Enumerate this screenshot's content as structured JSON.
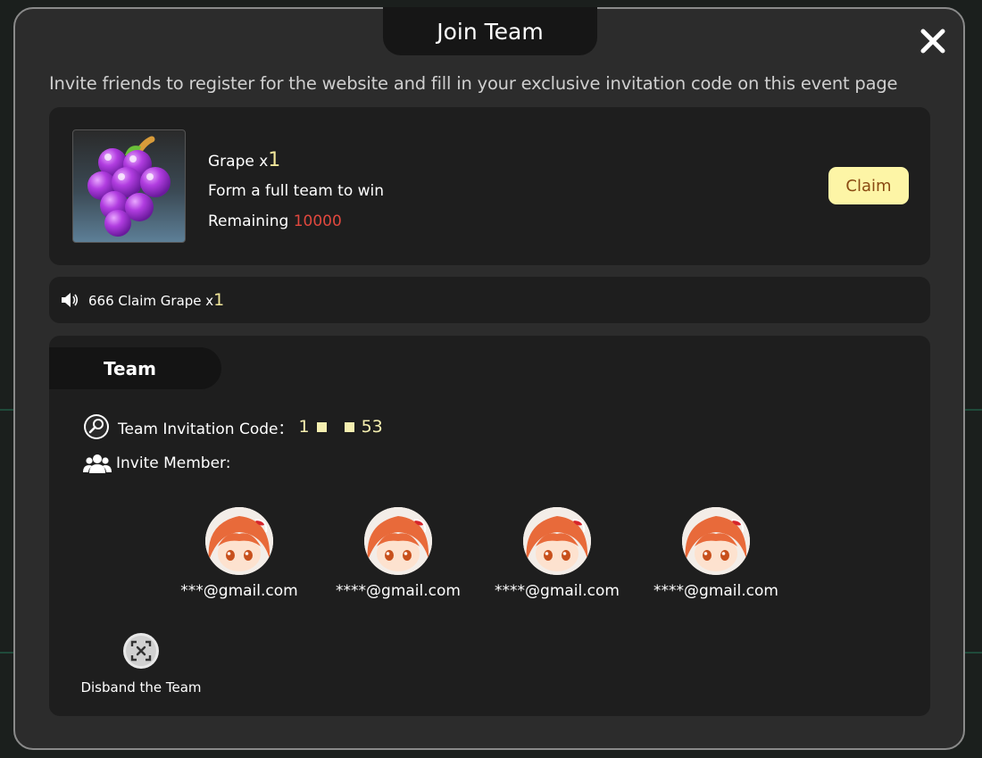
{
  "modal": {
    "title": "Join Team",
    "intro": "Invite friends to register for the website and fill in your exclusive invitation code on this event page"
  },
  "reward": {
    "item_name": "Grape x",
    "item_count": "1",
    "condition": "Form a full team to win",
    "remaining_label": "Remaining",
    "remaining_value": "10000",
    "claim_label": "Claim"
  },
  "notice": {
    "text": "666 Claim Grape x",
    "count": "1"
  },
  "team": {
    "tab_label": "Team",
    "code_label": "Team Invitation Code：",
    "code_prefix": "1",
    "code_suffix": "53",
    "invite_label": "Invite Member:",
    "members": [
      {
        "email": "***@gmail.com"
      },
      {
        "email": "****@gmail.com"
      },
      {
        "email": "****@gmail.com"
      },
      {
        "email": "****@gmail.com"
      }
    ],
    "disband_label": "Disband the Team"
  },
  "icons": {
    "close": "close-icon",
    "speaker": "speaker-icon",
    "code": "magnifier-icon",
    "invite": "users-icon",
    "disband": "disband-icon"
  },
  "colors": {
    "accent_yellow": "#fdf5a6",
    "remaining_red": "#e0483e",
    "modal_bg": "#2c2c2c"
  }
}
